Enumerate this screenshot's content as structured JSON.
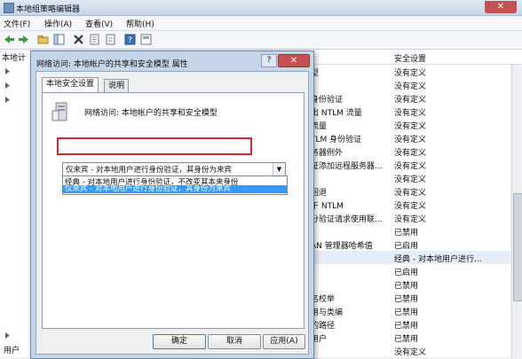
{
  "app": {
    "title": "本地组策略编辑器",
    "close_label": "✕"
  },
  "menu": [
    "文件(F)",
    "操作(A)",
    "查看(V)",
    "帮助(H)"
  ],
  "left_pane": {
    "header": "本地计",
    "footer_label": "用户"
  },
  "list": {
    "header_setting": "安全设置",
    "rows": [
      {
        "policy": "型",
        "setting": "没有定义"
      },
      {
        "policy": "",
        "setting": "没有定义"
      },
      {
        "policy": "身份验证",
        "setting": "没有定义"
      },
      {
        "policy": "出 NTLM 流量",
        "setting": "没有定义"
      },
      {
        "policy": "流量",
        "setting": "没有定义"
      },
      {
        "policy": "TLM 身份验证",
        "setting": "没有定义"
      },
      {
        "policy": "务器例外",
        "setting": "没有定义"
      },
      {
        "policy": "证添加远程服务器...",
        "setting": "没有定义"
      },
      {
        "policy": "",
        "setting": "没有定义"
      },
      {
        "policy": "回退",
        "setting": "没有定义"
      },
      {
        "policy": "于 NTLM",
        "setting": "没有定义"
      },
      {
        "policy": "分验证请求使用联...",
        "setting": "没有定义"
      },
      {
        "policy": "",
        "setting": "已禁用"
      },
      {
        "policy": "AN 管理器哈希值",
        "setting": "已启用"
      },
      {
        "policy": "",
        "setting": "经典 - 对本地用户进行..."
      },
      {
        "policy": "",
        "setting": "已启用"
      },
      {
        "policy": "",
        "setting": "已禁用"
      },
      {
        "policy": "名校举",
        "setting": "已禁用"
      },
      {
        "policy": "用与类编",
        "setting": "已禁用"
      },
      {
        "policy": "的路径",
        "setting": "已禁用"
      },
      {
        "policy": "用户",
        "setting": "已禁用"
      },
      {
        "policy": "",
        "setting": "没有定义"
      }
    ]
  },
  "dialog": {
    "title": "网络访问: 本地帐户的共享和安全模型 属性",
    "help_label": "?",
    "close_label": "✕",
    "tabs": [
      "本地安全设置",
      "说明"
    ],
    "policy_label": "网络访问: 本地帐户的共享和安全模型",
    "combo_value": "仅来宾 - 对本地用户进行身份验证，其身份为来宾",
    "options": [
      "经典 - 对本地用户进行身份验证，不改变其本来身份",
      "仅来宾 - 对本地用户进行身份验证，其身份为来宾"
    ],
    "buttons": {
      "ok": "确定",
      "cancel": "取消",
      "apply": "应用(A)"
    }
  },
  "colors": {
    "highlight": "#3399ff",
    "annotation": "#d0282e",
    "close_button": "#c75050"
  }
}
